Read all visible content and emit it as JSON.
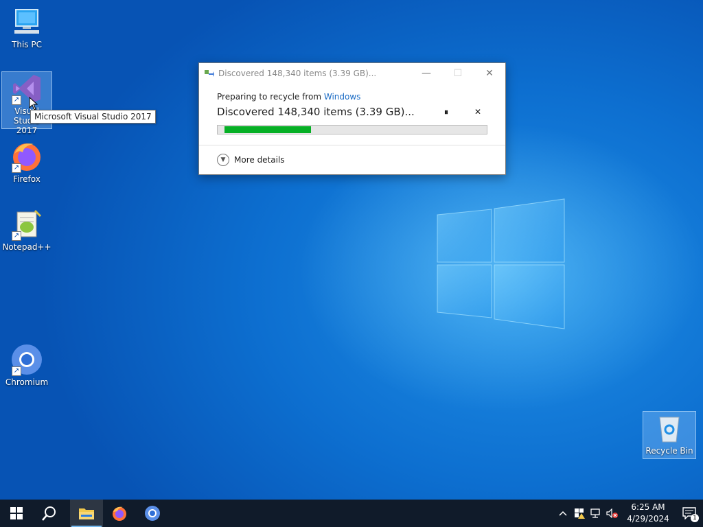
{
  "desktop": {
    "icons": [
      {
        "label": "This PC"
      },
      {
        "label": "Visual Studio 2017"
      },
      {
        "label": "Firefox"
      },
      {
        "label": "Notepad++"
      },
      {
        "label": "Chromium"
      },
      {
        "label": "Recycle Bin"
      }
    ],
    "tooltip": "Microsoft Visual Studio 2017"
  },
  "dialog": {
    "title": "Discovered 148,340 items (3.39 GB)...",
    "preparing_prefix": "Preparing to recycle from ",
    "preparing_location": "Windows",
    "status": "Discovered 148,340 items (3.39 GB)...",
    "pause_label": "⏸",
    "cancel_label": "✕",
    "progress_fraction": 0.33,
    "more_details": "More details",
    "minimize_label": "—",
    "maximize_label": "☐",
    "close_label": "✕"
  },
  "taskbar": {
    "clock_time": "6:25 AM",
    "clock_date": "4/29/2024",
    "notification_count": "1",
    "accent_color": "#76b9ed"
  },
  "colors": {
    "progress_green": "#06b025",
    "link_blue": "#1a6bc4"
  }
}
